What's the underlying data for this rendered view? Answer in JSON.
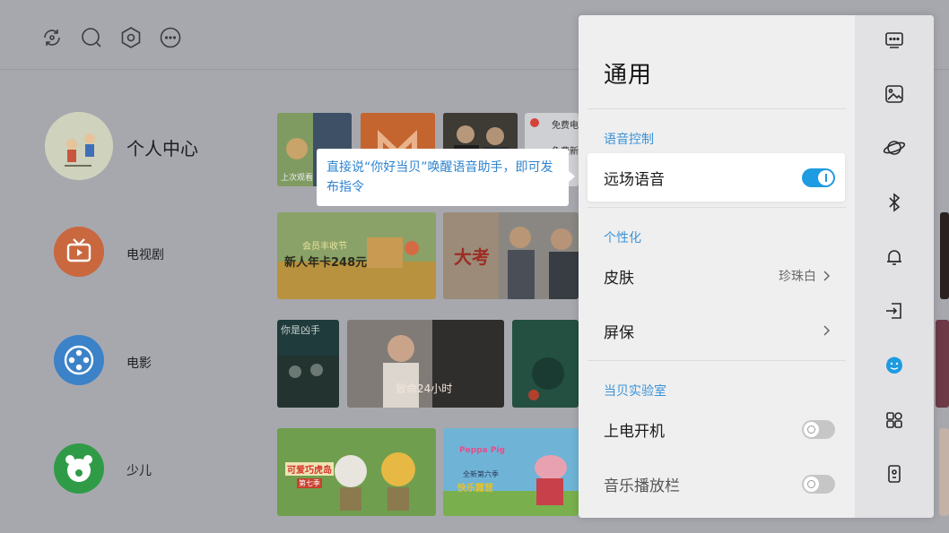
{
  "home": {
    "profile": {
      "label": "个人中心"
    },
    "categories": [
      {
        "label": "电视剧",
        "color": "#de6c3f"
      },
      {
        "label": "电影",
        "color": "#3f8ed6"
      },
      {
        "label": "少儿",
        "color": "#35a24c"
      }
    ],
    "tile_texts": {
      "t1_caption": "上次观看",
      "t3_line1": "免费电",
      "t3_line2": "免费新",
      "banner_line1": "会员丰收节",
      "banner_line2": "新人年卡248元",
      "show_title": "大考",
      "movie_title": "你是凶手",
      "movie2_title": "致命24小时",
      "kids_title": "可爱巧虎岛",
      "kids_sub": "第七季",
      "peppa_title": "Peppa Pig",
      "peppa_sub": "全新第六季",
      "peppa_sub2": "快乐露营"
    }
  },
  "tooltip": {
    "text": "直接说“你好当贝”唤醒语音助手，即可发布指令"
  },
  "settings": {
    "title": "通用",
    "sections": [
      {
        "header": "语音控制"
      },
      {
        "header": "个性化"
      },
      {
        "header": "当贝实验室"
      }
    ],
    "rows": {
      "far_voice": {
        "label": "远场语音",
        "state": "on"
      },
      "skin": {
        "label": "皮肤",
        "value": "珍珠白"
      },
      "screensaver": {
        "label": "屏保"
      },
      "power_on_boot": {
        "label": "上电开机",
        "state": "off"
      },
      "music_bar": {
        "label": "音乐播放栏",
        "state": "off"
      }
    }
  },
  "rail": {
    "icons": [
      "display-icon",
      "picture-icon",
      "planet-icon",
      "bluetooth-icon",
      "bell-icon",
      "input-source-icon",
      "face-icon",
      "apps-icon",
      "device-icon"
    ],
    "active_index": 6,
    "accent": "#1f9be1"
  }
}
